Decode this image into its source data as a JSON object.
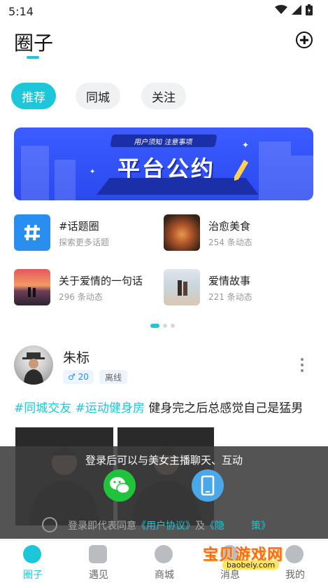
{
  "status_bar": {
    "time": "5:14"
  },
  "header": {
    "title": "圈子"
  },
  "tabs": [
    {
      "label": "推荐",
      "active": true
    },
    {
      "label": "同城",
      "active": false
    },
    {
      "label": "关注",
      "active": false
    }
  ],
  "banner": {
    "pill_text": "用户须知 注意事项",
    "title": "平台公约"
  },
  "topics": [
    {
      "name": "#话题圈",
      "sub": "探索更多话题",
      "icon": "hash-icon"
    },
    {
      "name": "治愈美食",
      "sub": "254 条动态",
      "icon": "food-photo"
    },
    {
      "name": "关于爱情的一句话",
      "sub": "296 条动态",
      "icon": "sunset-couple-photo"
    },
    {
      "name": "爱情故事",
      "sub": "221 条动态",
      "icon": "beach-couple-photo"
    }
  ],
  "post": {
    "user_name": "朱标",
    "gender_icon": "male-icon",
    "level": "20",
    "status": "离线",
    "tags": [
      "#同城交友",
      "#运动健身房"
    ],
    "text": "健身完之后总感觉自己是猛男"
  },
  "login_overlay": {
    "message": "登录后可以与美女主播聊天、互动",
    "agree_prefix": "登录即代表同意",
    "user_agreement": "《用户协议》",
    "and": "及",
    "privacy": "《隐",
    "privacy_tail": "策》"
  },
  "watermark": {
    "title": "宝贝游戏网",
    "url": "baobeiy.com"
  },
  "bottom_nav": [
    {
      "label": "圈子",
      "active": true
    },
    {
      "label": "遇见",
      "active": false
    },
    {
      "label": "商城",
      "active": false
    },
    {
      "label": "消息",
      "active": false
    },
    {
      "label": "我的",
      "active": false
    }
  ],
  "colors": {
    "accent": "#1bc7d8",
    "banner": "#3b5cff",
    "wechat": "#20c43a",
    "phone": "#4aa8e8"
  }
}
